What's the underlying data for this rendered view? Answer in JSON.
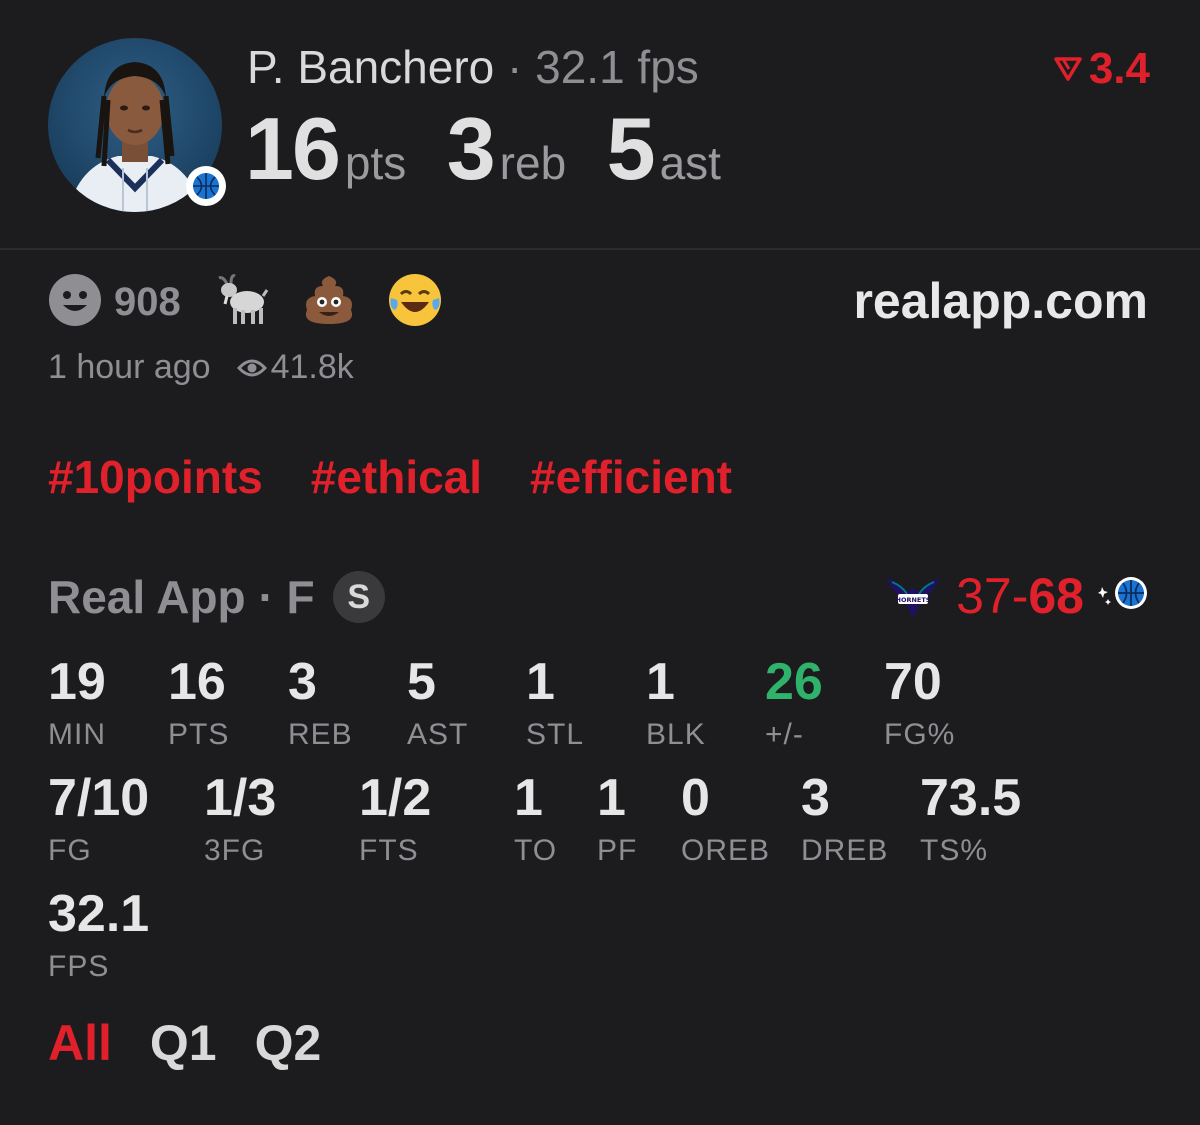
{
  "player": {
    "name": "P. Banchero",
    "separator": "·",
    "fps_text": "32.1 fps",
    "pts": "16",
    "pts_unit": "pts",
    "reb": "3",
    "reb_unit": "reb",
    "ast": "5",
    "ast_unit": "ast"
  },
  "trend": {
    "value": "3.4",
    "color": "#e0212b"
  },
  "reactions": {
    "count": "908",
    "emojis": [
      "goat-emoji",
      "poop-emoji",
      "laughing-emoji"
    ],
    "time_ago": "1 hour ago",
    "views": "41.8k"
  },
  "site": "realapp.com",
  "tags": [
    "#10points",
    "#ethical",
    "#efficient"
  ],
  "game": {
    "source": "Real App",
    "dot": "·",
    "position": "F",
    "badge": "S",
    "score_left": "37",
    "score_dash": "-",
    "score_right": "68"
  },
  "stats_row1": [
    {
      "value": "19",
      "label": "MIN"
    },
    {
      "value": "16",
      "label": "PTS"
    },
    {
      "value": "3",
      "label": "REB"
    },
    {
      "value": "5",
      "label": "AST"
    },
    {
      "value": "1",
      "label": "STL"
    },
    {
      "value": "1",
      "label": "BLK"
    },
    {
      "value": "26",
      "label": "+/-"
    },
    {
      "value": "70",
      "label": "FG%"
    }
  ],
  "stats_row2": [
    {
      "value": "7/10",
      "label": "FG"
    },
    {
      "value": "1/3",
      "label": "3FG"
    },
    {
      "value": "1/2",
      "label": "FTS"
    },
    {
      "value": "1",
      "label": "TO"
    },
    {
      "value": "1",
      "label": "PF"
    },
    {
      "value": "0",
      "label": "OREB"
    },
    {
      "value": "3",
      "label": "DREB"
    },
    {
      "value": "73.5",
      "label": "TS%"
    }
  ],
  "stats_row3": [
    {
      "value": "32.1",
      "label": "FPS"
    }
  ],
  "periods": [
    "All",
    "Q1",
    "Q2"
  ],
  "colors": {
    "accent_red": "#e0212b",
    "positive_green": "#2fb36a",
    "background": "#1c1c1e"
  }
}
